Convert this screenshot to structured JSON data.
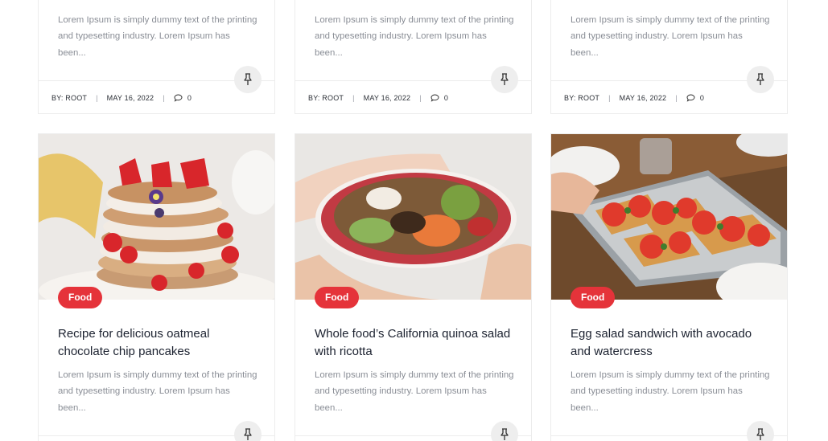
{
  "colors": {
    "accent": "#e5333a",
    "text_muted": "#8a8e96",
    "border": "#ececec"
  },
  "top_row": [
    {
      "excerpt": "Lorem Ipsum is simply dummy text of the printing and typesetting industry. Lorem Ipsum has been...",
      "author": "BY: ROOT",
      "date": "MAY 16, 2022",
      "comments": "0",
      "pin_icon": "pin-icon"
    },
    {
      "excerpt": "Lorem Ipsum is simply dummy text of the printing and typesetting industry. Lorem Ipsum has been...",
      "author": "BY: ROOT",
      "date": "MAY 16, 2022",
      "comments": "0",
      "pin_icon": "pin-icon"
    },
    {
      "excerpt": "Lorem Ipsum is simply dummy text of the printing and typesetting industry. Lorem Ipsum has been...",
      "author": "BY: ROOT",
      "date": "MAY 16, 2022",
      "comments": "0",
      "pin_icon": "pin-icon"
    }
  ],
  "bottom_row": [
    {
      "category": "Food",
      "title": "Recipe for delicious oatmeal chocolate chip pancakes",
      "excerpt": "Lorem Ipsum is simply dummy text of the printing and typesetting industry. Lorem Ipsum has been...",
      "image": "pancake-stack-image"
    },
    {
      "category": "Food",
      "title": "Whole food’s California quinoa salad with ricotta",
      "excerpt": "Lorem Ipsum is simply dummy text of the printing and typesetting industry. Lorem Ipsum has been...",
      "image": "quinoa-salad-bowl-image"
    },
    {
      "category": "Food",
      "title": "Egg salad sandwich with avocado and watercress",
      "excerpt": "Lorem Ipsum is simply dummy text of the printing and typesetting industry. Lorem Ipsum has been...",
      "image": "tomato-toast-tray-image"
    }
  ]
}
